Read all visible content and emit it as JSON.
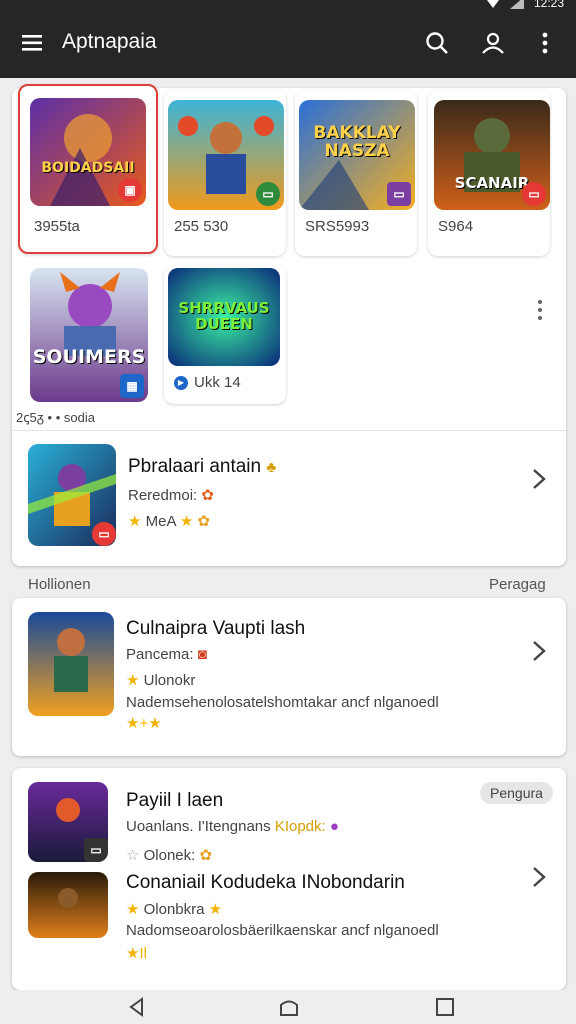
{
  "status": {
    "time": "12:23"
  },
  "appbar": {
    "title": "Aptnapaia",
    "menu_icon": "menu-icon",
    "search_icon": "search-icon",
    "account_icon": "account-icon",
    "more_icon": "more-vert-icon"
  },
  "grid": {
    "tiles": [
      {
        "art_text": "BOIDADSAII",
        "caption": "3955ta"
      },
      {
        "art_text": "",
        "caption": "255 530"
      },
      {
        "art_text": "BAKKLAY NASZA",
        "caption": "SRS5993"
      },
      {
        "art_text": "SCANAIR",
        "caption": "S964"
      },
      {
        "art_text": "SOUIMERS",
        "caption": ""
      },
      {
        "art_text": "SHRRVAUS DUEEN",
        "caption": "Ukk 14"
      }
    ],
    "footnote": "2ꞔ5ᵹ • • sodia"
  },
  "featured": {
    "title": "Pbralaari antain",
    "line2": "Reredmoi:",
    "line3": "MeA"
  },
  "section": {
    "left_label": "Hollionen",
    "right_label": "Peragag"
  },
  "item1": {
    "title": "Culnaipra Vaupti lash",
    "line2": "Pancema:",
    "line3": "Ulonokr",
    "line4": "Nademsehenolosatelshomtakar ancf nlganoedl",
    "rating": "★+★"
  },
  "item2": {
    "pill": "Pengura",
    "title_a": "Payiil I laen",
    "line_a2": "Uoanlans. I'Itengnans",
    "line_a2_tag": "KIopdk:",
    "line_a3": "Olonek:",
    "title_b": "Conaniail Kodudeka INobondarin",
    "line_b2": "Olonbkra",
    "line_b3": "Nadomseoarolosbäerilkaenskar ancf nlganoedl",
    "rating": "★Il"
  },
  "colors": {
    "topbar": "#262626",
    "selected_border": "#e0403a",
    "star": "#f2b400"
  }
}
